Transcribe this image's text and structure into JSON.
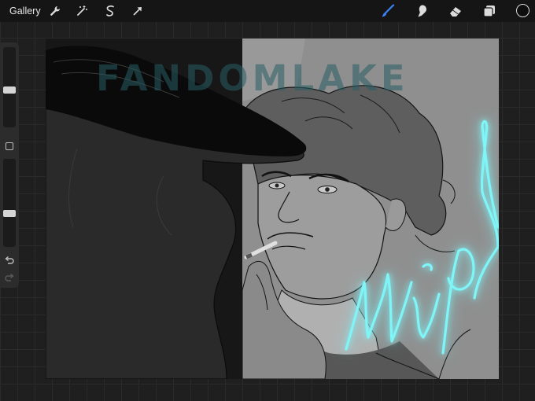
{
  "toolbar": {
    "gallery_label": "Gallery",
    "left_tools": [
      "wrench-icon",
      "magic-wand-icon",
      "selection-icon",
      "transform-arrow-icon"
    ],
    "right_tools": [
      "brush-icon",
      "smudge-icon",
      "eraser-icon",
      "layers-icon"
    ],
    "active_tool": "brush",
    "active_tool_color": "#3b82f6",
    "current_color": "#0e0e0e"
  },
  "sidebar": {
    "brush_size_level": 0.46,
    "opacity_level": 0.37
  },
  "canvas": {
    "watermark_text": "FANDOMLAKE",
    "neon_text": "Мир!",
    "neon_color": "#7ff5f8"
  }
}
